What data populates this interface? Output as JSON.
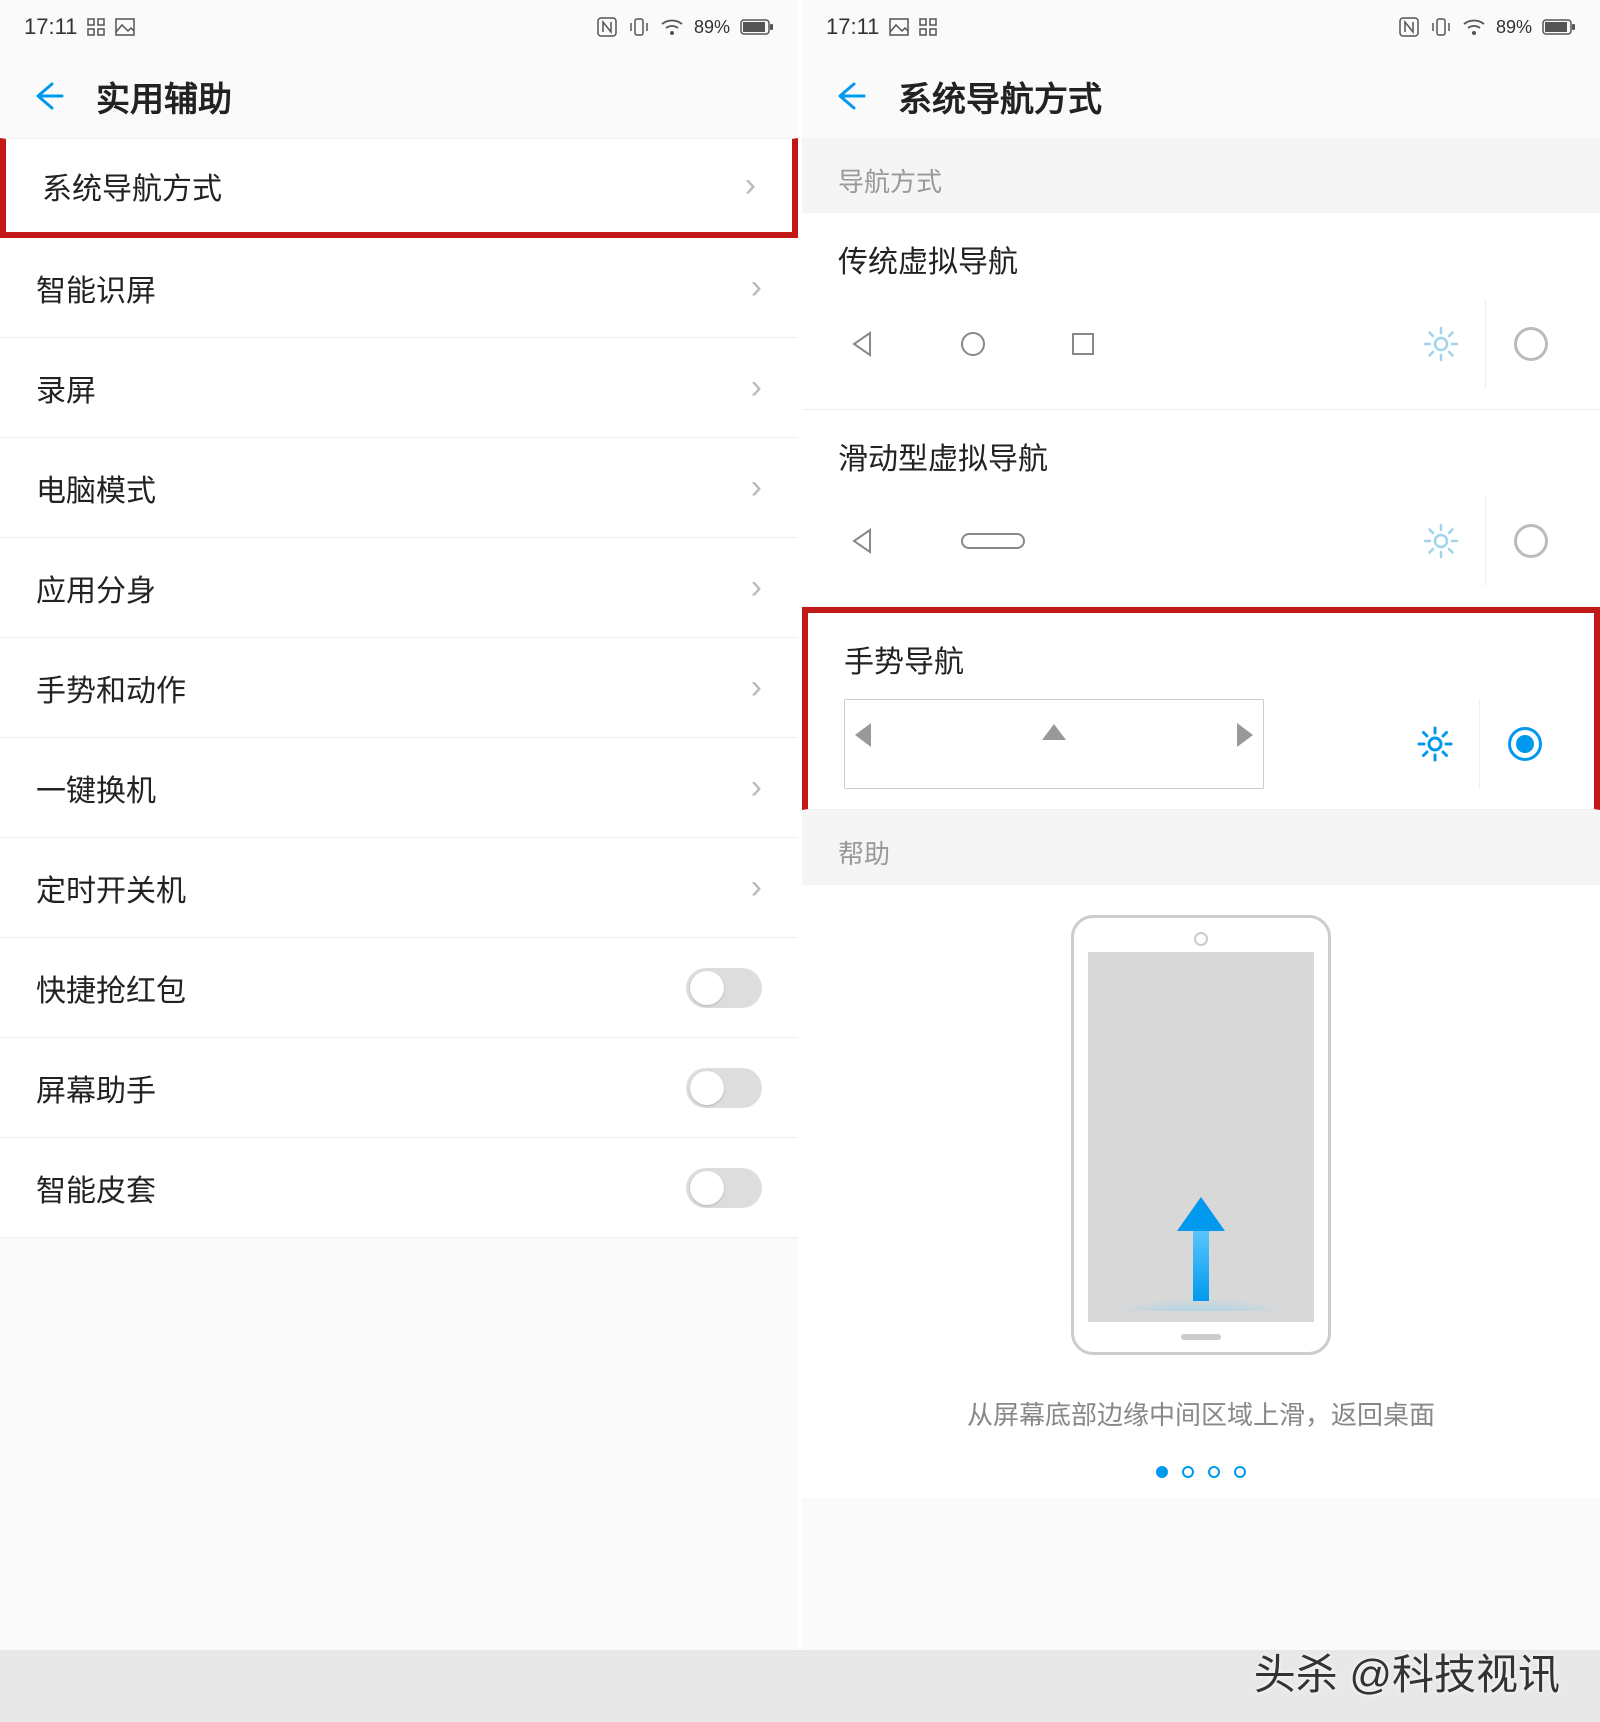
{
  "statusbar": {
    "time": "17:11",
    "battery": "89%"
  },
  "left": {
    "title": "实用辅助",
    "items": [
      {
        "label": "系统导航方式",
        "type": "chevron",
        "highlighted": true
      },
      {
        "label": "智能识屏",
        "type": "chevron"
      },
      {
        "label": "录屏",
        "type": "chevron"
      },
      {
        "label": "电脑模式",
        "type": "chevron"
      },
      {
        "label": "应用分身",
        "type": "chevron"
      },
      {
        "label": "手势和动作",
        "type": "chevron"
      },
      {
        "label": "一键换机",
        "type": "chevron"
      },
      {
        "label": "定时开关机",
        "type": "chevron"
      },
      {
        "label": "快捷抢红包",
        "type": "toggle",
        "value": false
      },
      {
        "label": "屏幕助手",
        "type": "toggle",
        "value": false
      },
      {
        "label": "智能皮套",
        "type": "toggle",
        "value": false
      }
    ]
  },
  "right": {
    "title": "系统导航方式",
    "section_nav": "导航方式",
    "options": [
      {
        "label": "传统虚拟导航",
        "selected": false,
        "preview": "classic"
      },
      {
        "label": "滑动型虚拟导航",
        "selected": false,
        "preview": "pill"
      },
      {
        "label": "手势导航",
        "selected": true,
        "preview": "gesture",
        "highlighted": true
      }
    ],
    "section_help": "帮助",
    "help_text": "从屏幕底部边缘中间区域上滑，返回桌面",
    "pager_count": 4,
    "pager_active": 0
  },
  "watermark": "头杀 @科技视讯"
}
